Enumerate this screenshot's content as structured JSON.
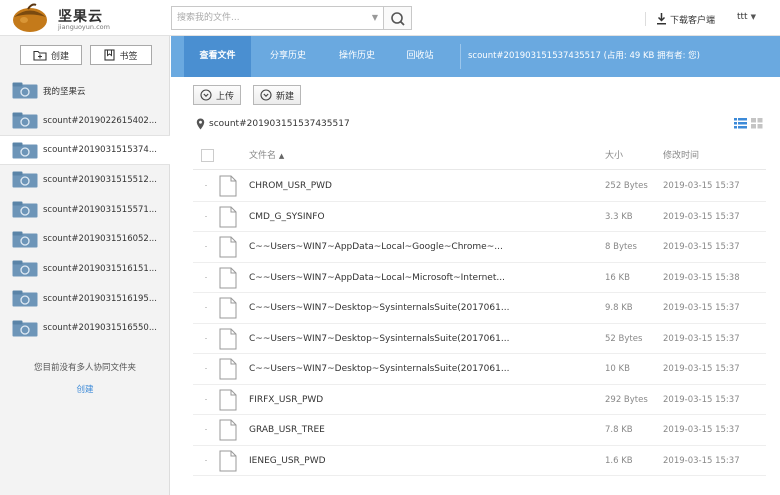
{
  "app": {
    "logo_text": "坚果云",
    "logo_sub": "jianguoyun.com"
  },
  "search": {
    "placeholder": "搜索我的文件...",
    "value": ""
  },
  "header": {
    "download_label": "下载客户端",
    "user_name": "ttt"
  },
  "sidebar": {
    "create_label": "创建",
    "bookmark_label": "书签",
    "items": [
      {
        "label": "我的坚果云"
      },
      {
        "label": "scount#2019022615402..."
      },
      {
        "label": "scount#2019031515374..."
      },
      {
        "label": "scount#2019031515512..."
      },
      {
        "label": "scount#2019031515571..."
      },
      {
        "label": "scount#2019031516052..."
      },
      {
        "label": "scount#2019031516151..."
      },
      {
        "label": "scount#2019031516195..."
      },
      {
        "label": "scount#2019031516550..."
      }
    ],
    "active_index": 2,
    "empty_note": "您目前没有多人协同文件夹",
    "create_link": "创建"
  },
  "tabs": {
    "items": [
      {
        "label": "查看文件"
      },
      {
        "label": "分享历史"
      },
      {
        "label": "操作历史"
      },
      {
        "label": "回收站"
      }
    ],
    "active_index": 0,
    "info": "scount#201903151537435517  (占用:  49 KB   拥有者:  您)"
  },
  "toolbar": {
    "upload_label": "上传",
    "new_label": "新建",
    "path": "scount#201903151537435517"
  },
  "table": {
    "col_name": "文件名",
    "col_size": "大小",
    "col_time": "修改时间",
    "rows": [
      {
        "name": "CHROM_USR_PWD",
        "size": "252 Bytes",
        "time": "2019-03-15 15:37"
      },
      {
        "name": "CMD_G_SYSINFO",
        "size": "3.3 KB",
        "time": "2019-03-15 15:37"
      },
      {
        "name": "C~~Users~WIN7~AppData~Local~Google~Chrome~...",
        "size": "8 Bytes",
        "time": "2019-03-15 15:37"
      },
      {
        "name": "C~~Users~WIN7~AppData~Local~Microsoft~Internet...",
        "size": "16 KB",
        "time": "2019-03-15 15:38"
      },
      {
        "name": "C~~Users~WIN7~Desktop~SysinternalsSuite(2017061...",
        "size": "9.8 KB",
        "time": "2019-03-15 15:37"
      },
      {
        "name": "C~~Users~WIN7~Desktop~SysinternalsSuite(2017061...",
        "size": "52 Bytes",
        "time": "2019-03-15 15:37"
      },
      {
        "name": "C~~Users~WIN7~Desktop~SysinternalsSuite(2017061...",
        "size": "10 KB",
        "time": "2019-03-15 15:37"
      },
      {
        "name": "FIRFX_USR_PWD",
        "size": "292 Bytes",
        "time": "2019-03-15 15:37"
      },
      {
        "name": "GRAB_USR_TREE",
        "size": "7.8 KB",
        "time": "2019-03-15 15:37"
      },
      {
        "name": "IENEG_USR_PWD",
        "size": "1.6 KB",
        "time": "2019-03-15 15:37"
      }
    ]
  },
  "colors": {
    "tab_bar": "#6aa9e0",
    "tab_active": "#4a8fd1",
    "link": "#3c8ad8",
    "folder_icon": "#5b8fb8"
  }
}
